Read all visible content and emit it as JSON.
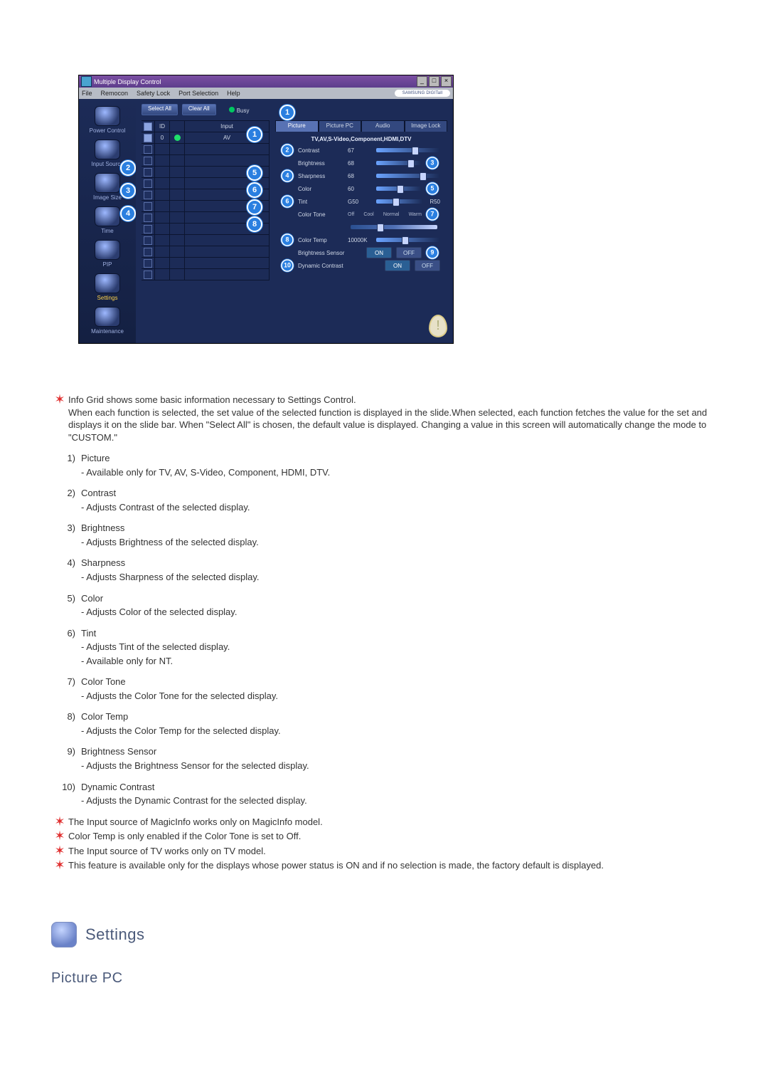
{
  "window": {
    "title": "Multiple Display Control",
    "menus": [
      "File",
      "Remocon",
      "Safety Lock",
      "Port Selection",
      "Help"
    ],
    "samsung_badge": "SAMSUNG DIGITall"
  },
  "sidebar": {
    "items": [
      {
        "label": "Power Control"
      },
      {
        "label": "Input Source"
      },
      {
        "label": "Image Size"
      },
      {
        "label": "Time"
      },
      {
        "label": "PIP"
      },
      {
        "label": "Settings"
      },
      {
        "label": "Maintenance"
      }
    ]
  },
  "toolbar": {
    "select_all": "Select All",
    "clear_all": "Clear All",
    "busy_label": "Busy"
  },
  "grid": {
    "headers": {
      "id_col": "ID",
      "input_col": "Input"
    },
    "row0_id": "0",
    "row0_input": "AV"
  },
  "panel": {
    "tabs": [
      "Picture",
      "Picture PC",
      "Audio",
      "Image Lock"
    ],
    "subhead": "TV,AV,S-Video,Component,HDMI,DTV",
    "sliders": [
      {
        "label": "Contrast",
        "value": "67",
        "pos": 55
      },
      {
        "label": "Brightness",
        "value": "68",
        "pos": 68
      },
      {
        "label": "Sharpness",
        "value": "68",
        "pos": 68
      },
      {
        "label": "Color",
        "value": "60",
        "pos": 45
      }
    ],
    "tint": {
      "label": "Tint",
      "left": "G50",
      "right": "R50",
      "pos": 35
    },
    "tone": {
      "label": "Color Tone",
      "options": [
        "Off",
        "Cool",
        "Normal",
        "Warm"
      ],
      "pos": 30
    },
    "temp": {
      "label": "Color Temp",
      "value": "10000K",
      "pos": 40
    },
    "brightness_sensor": {
      "label": "Brightness Sensor",
      "on": "ON",
      "off": "OFF"
    },
    "dynamic_contrast": {
      "label": "Dynamic Contrast",
      "on": "ON",
      "off": "OFF"
    }
  },
  "doc": {
    "intro_note": "Info Grid shows some basic information necessary to Settings Control.\nWhen each function is selected, the set value of the selected function is displayed in the slide.When selected, each function fetches the value for the set and displays it on the slide bar. When \"Select All\" is chosen, the default value is displayed. Changing a value in this screen will automatically change the mode to \"CUSTOM.\"",
    "items": [
      {
        "num": "1)",
        "title": "Picture",
        "details": [
          "Available only for TV, AV, S-Video, Component, HDMI, DTV."
        ]
      },
      {
        "num": "2)",
        "title": "Contrast",
        "details": [
          "Adjusts Contrast of the selected display."
        ]
      },
      {
        "num": "3)",
        "title": "Brightness",
        "details": [
          "Adjusts Brightness of the selected display."
        ]
      },
      {
        "num": "4)",
        "title": "Sharpness",
        "details": [
          "Adjusts Sharpness of the selected display."
        ]
      },
      {
        "num": "5)",
        "title": "Color",
        "details": [
          "Adjusts Color of the selected display."
        ]
      },
      {
        "num": "6)",
        "title": "Tint",
        "details": [
          "Adjusts Tint of the selected display.",
          "Available  only for NT."
        ]
      },
      {
        "num": "7)",
        "title": "Color Tone",
        "details": [
          "Adjusts the Color Tone for the selected display."
        ]
      },
      {
        "num": "8)",
        "title": "Color Temp",
        "details": [
          "Adjusts the Color Temp for the selected display."
        ]
      },
      {
        "num": "9)",
        "title": "Brightness Sensor",
        "details": [
          "Adjusts the Brightness Sensor for the selected display."
        ]
      },
      {
        "num": "10)",
        "title": "Dynamic Contrast",
        "details": [
          "Adjusts the Dynamic Contrast for the selected display."
        ]
      }
    ],
    "notes": [
      "The Input source of MagicInfo works only on MagicInfo model.",
      "Color Temp is only enabled if the Color Tone is set to Off.",
      "The Input source of TV works only on TV model.",
      "This feature is available only for the displays whose power status is ON and if no selection is made, the factory default is displayed."
    ],
    "settings_title": "Settings",
    "sub_title": "Picture PC"
  }
}
